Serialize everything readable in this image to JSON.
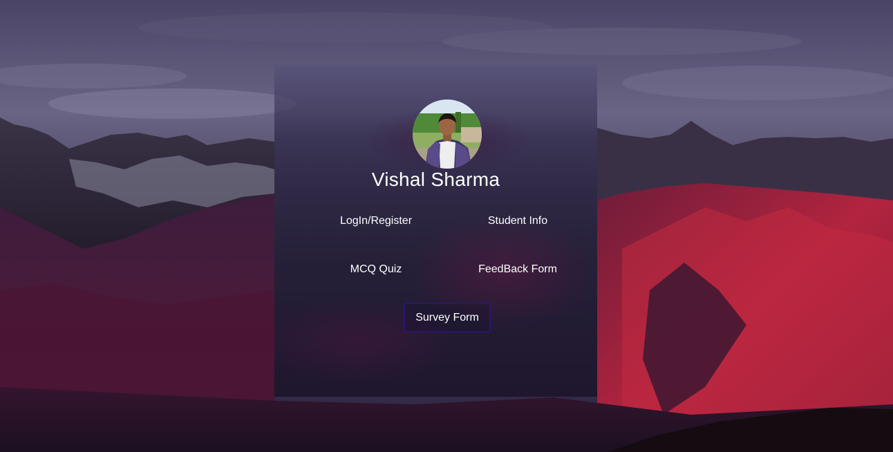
{
  "profile": {
    "name": "Vishal Sharma",
    "avatar_alt": "profile photo"
  },
  "nav": {
    "login_register": "LogIn/Register",
    "student_info": "Student Info",
    "mcq_quiz": "MCQ Quiz",
    "feedback_form": "FeedBack Form",
    "survey_form": "Survey Form"
  },
  "colors": {
    "text": "#ffffff",
    "survey_border": "#2c1670",
    "mountain_red": "#a4203f",
    "sky": "#5e5677"
  }
}
